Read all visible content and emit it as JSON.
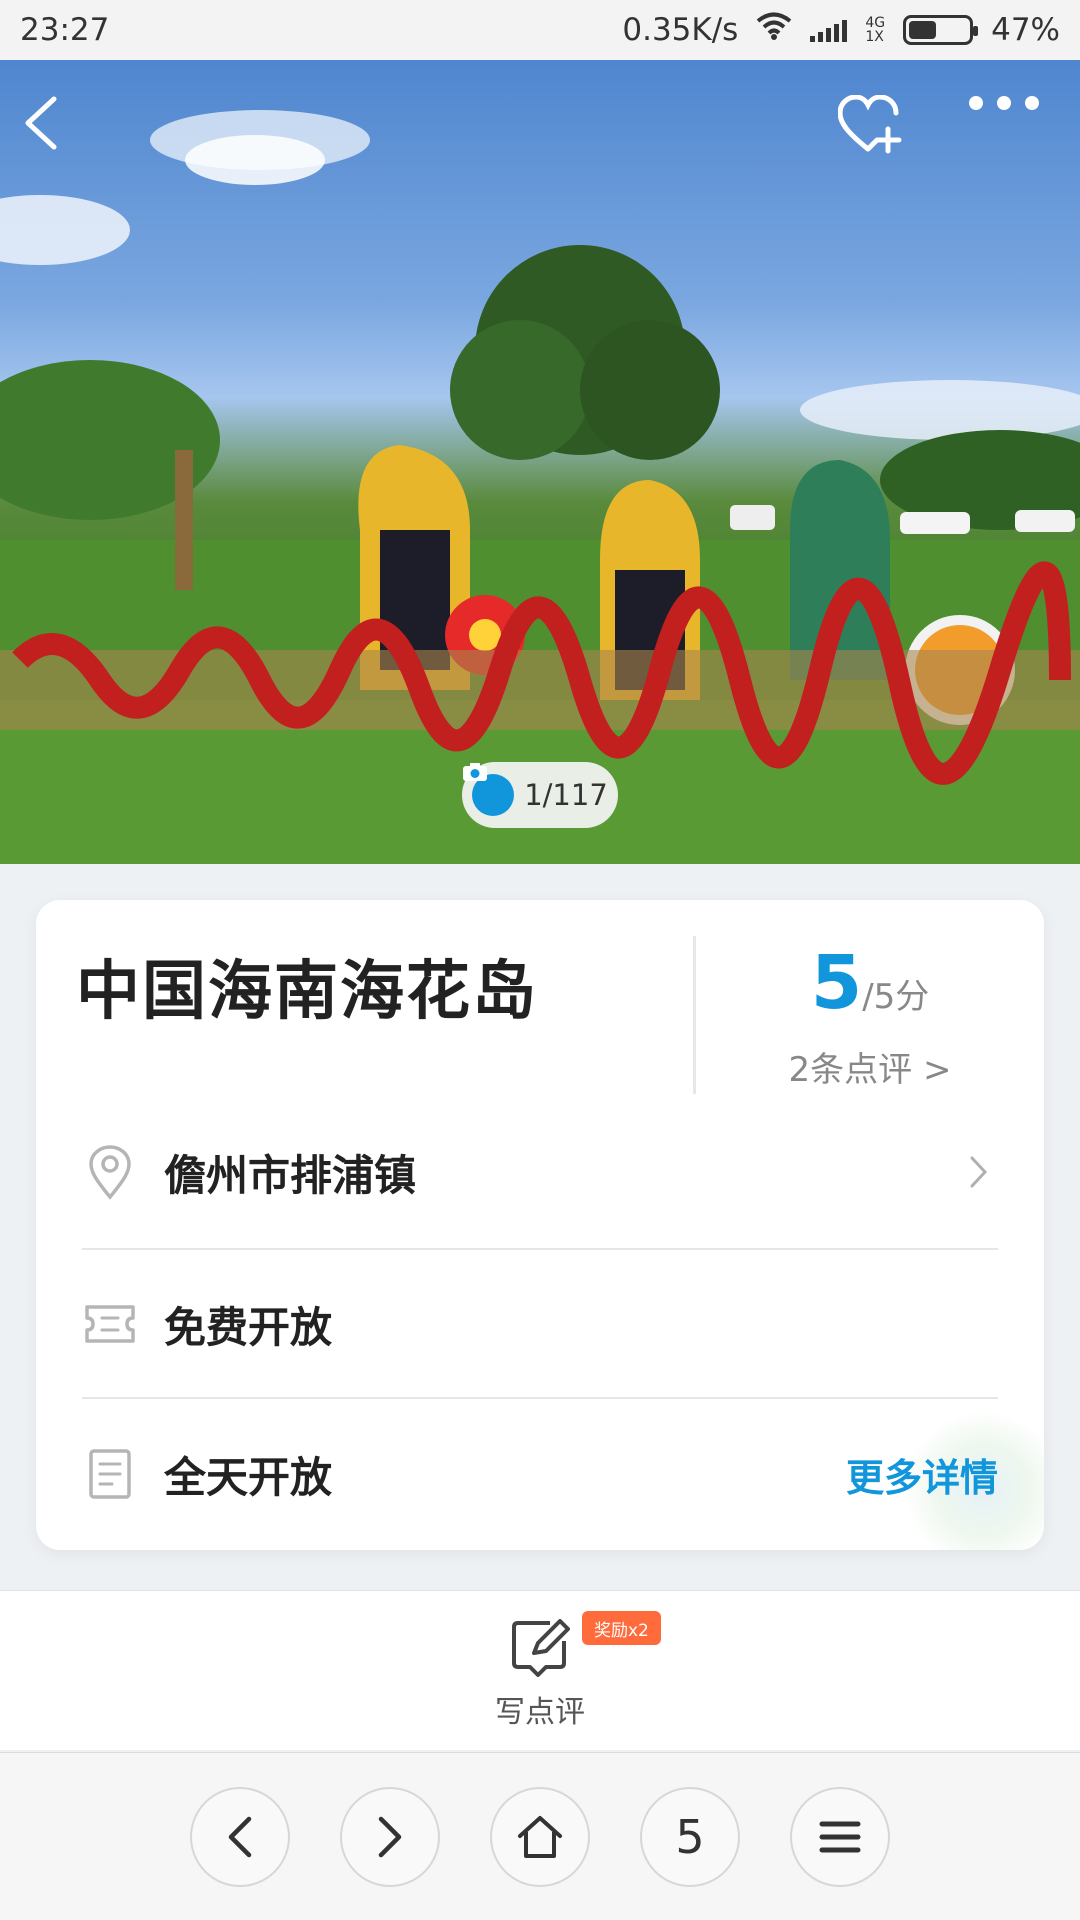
{
  "status_bar": {
    "time": "23:27",
    "net_speed": "0.35K/s",
    "net_type_top": "4G",
    "net_type_bottom": "1X",
    "battery": "47%",
    "battery_level": 0.47
  },
  "hero": {
    "photo_counter": "1/117"
  },
  "attraction": {
    "title": "中国海南海花岛",
    "score": "5",
    "score_unit": "/5分",
    "review_count_link": "2条点评 >",
    "location": "儋州市排浦镇",
    "ticket": "免费开放",
    "hours": "全天开放",
    "more_details": "更多详情"
  },
  "review_bar": {
    "write_label": "写点评",
    "reward_badge": "奖励x2"
  },
  "browser_nav": {
    "tab_count": "5"
  },
  "colors": {
    "accent": "#1296db",
    "reward": "#ff6b3b",
    "text_primary": "#222222",
    "text_secondary": "#888888"
  }
}
